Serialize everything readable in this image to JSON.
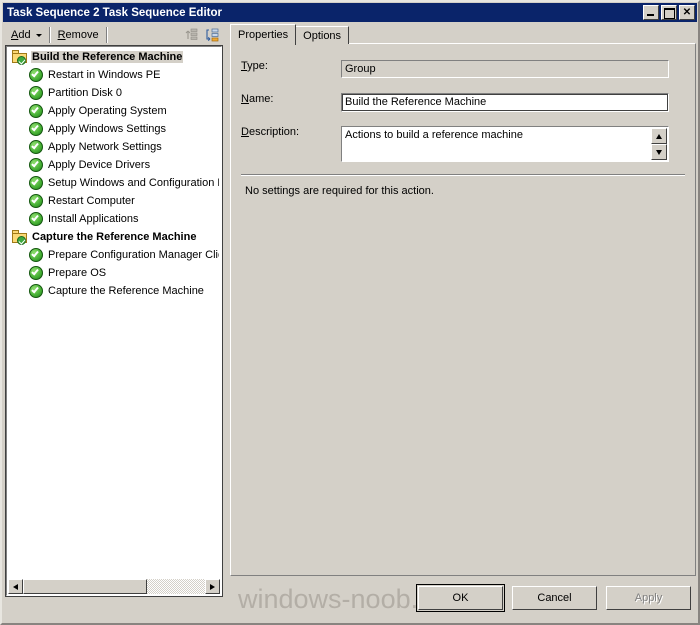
{
  "window": {
    "title": "Task Sequence 2 Task Sequence Editor",
    "minimize_label": "Minimize",
    "maximize_label": "Maximize",
    "close_label": "✕"
  },
  "toolbar": {
    "add_label": "Add",
    "add_mnemonic": "A",
    "remove_label": "Remove",
    "remove_mnemonic": "R",
    "icon_move_label": "move-up-down",
    "icon_order_label": "reorder"
  },
  "tree": {
    "items": [
      {
        "label": "Build the Reference Machine",
        "type": "group",
        "icon": "folder-check-icon",
        "selected": true
      },
      {
        "label": "Restart in Windows PE",
        "type": "action",
        "icon": "green-check-icon",
        "selected": false
      },
      {
        "label": "Partition Disk 0",
        "type": "action",
        "icon": "green-check-icon",
        "selected": false
      },
      {
        "label": "Apply Operating System",
        "type": "action",
        "icon": "green-check-icon",
        "selected": false
      },
      {
        "label": "Apply Windows Settings",
        "type": "action",
        "icon": "green-check-icon",
        "selected": false
      },
      {
        "label": "Apply Network Settings",
        "type": "action",
        "icon": "green-check-icon",
        "selected": false
      },
      {
        "label": "Apply Device Drivers",
        "type": "action",
        "icon": "green-check-icon",
        "selected": false
      },
      {
        "label": "Setup Windows and Configuration Manager",
        "type": "action",
        "icon": "green-check-icon",
        "selected": false
      },
      {
        "label": "Restart Computer",
        "type": "action",
        "icon": "green-check-icon",
        "selected": false
      },
      {
        "label": "Install Applications",
        "type": "action",
        "icon": "green-check-icon",
        "selected": false
      },
      {
        "label": "Capture the Reference Machine",
        "type": "group",
        "icon": "folder-check-icon",
        "selected": false
      },
      {
        "label": "Prepare Configuration Manager Client",
        "type": "action",
        "icon": "green-check-icon",
        "selected": false
      },
      {
        "label": "Prepare OS",
        "type": "action",
        "icon": "green-check-icon",
        "selected": false
      },
      {
        "label": "Capture the Reference Machine",
        "type": "action",
        "icon": "green-check-icon",
        "selected": false
      }
    ]
  },
  "tabs": [
    {
      "label": "Properties",
      "active": true
    },
    {
      "label": "Options",
      "active": false
    }
  ],
  "properties": {
    "type_label": "Type:",
    "type_mnemonic": "T",
    "type_rest": "ype:",
    "type_value": "Group",
    "name_label": "Name:",
    "name_mnemonic": "N",
    "name_rest": "ame:",
    "name_value": "Build the Reference Machine",
    "description_mnemonic": "D",
    "description_rest": "escription:",
    "description_value": "Actions to build a reference machine",
    "note": "No settings are required  for this action."
  },
  "footer": {
    "watermark": "windows-noob.com",
    "ok_label": "OK",
    "cancel_label": "Cancel",
    "apply_label": "Apply"
  }
}
